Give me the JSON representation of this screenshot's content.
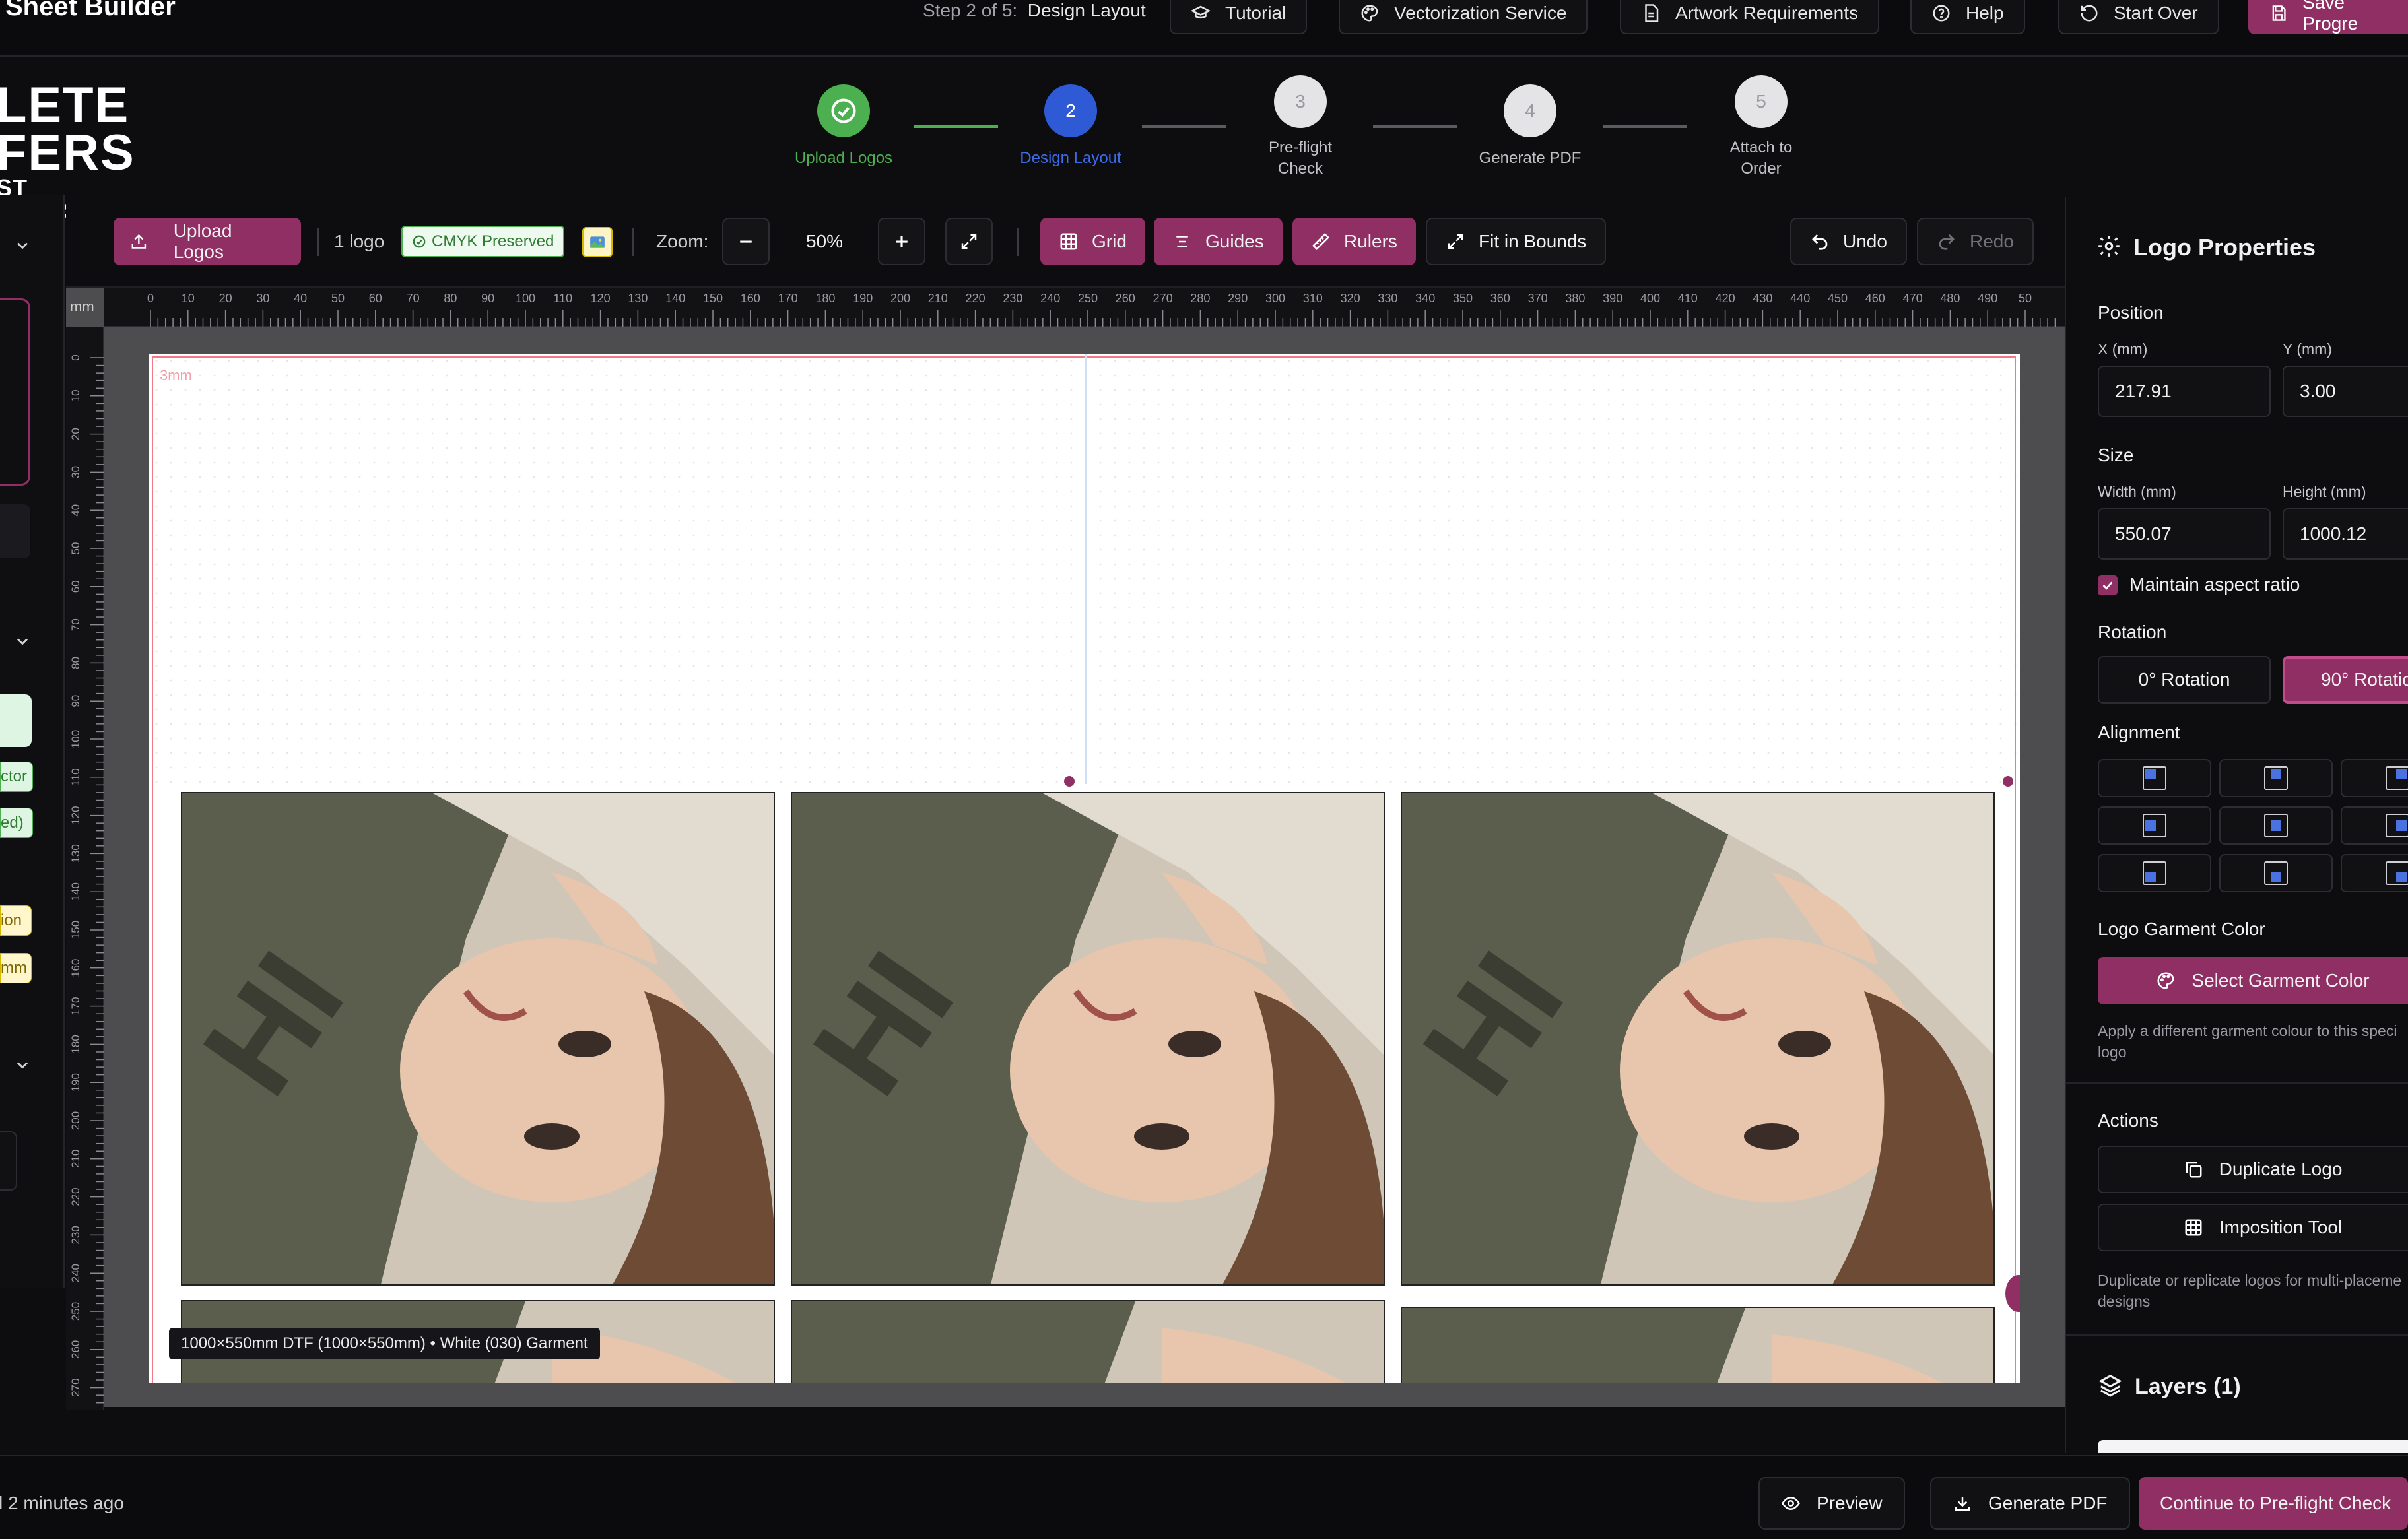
{
  "header": {
    "app_title": "Sheet Builder",
    "step_prefix": "Step 2 of 5:",
    "step_name": "Design Layout",
    "buttons": {
      "tutorial": "Tutorial",
      "vectorization": "Vectorization Service",
      "artwork": "Artwork Requirements",
      "help": "Help",
      "start_over": "Start Over",
      "save_progress": "Save Progre"
    }
  },
  "brand": {
    "line1": "LETE",
    "line2": "FERS",
    "line3": "ST PRESS"
  },
  "stepper": {
    "steps": [
      {
        "number": "1",
        "label": "Upload Logos",
        "status": "complete"
      },
      {
        "number": "2",
        "label": "Design Layout",
        "status": "current"
      },
      {
        "number": "3",
        "label": "Pre-flight Check",
        "status": "pending"
      },
      {
        "number": "4",
        "label": "Generate PDF",
        "status": "pending"
      },
      {
        "number": "5",
        "label": "Attach to Order",
        "status": "pending"
      }
    ]
  },
  "left_panel": {
    "tags": [
      "ctor",
      "ed)",
      "ion",
      "mm"
    ]
  },
  "toolbar": {
    "upload_logos": "Upload Logos",
    "logo_count": "1 logo",
    "cmyk_badge": "CMYK Preserved",
    "zoom_label": "Zoom:",
    "zoom_value": "50%",
    "grid": "Grid",
    "guides": "Guides",
    "rulers": "Rulers",
    "fit_in_bounds": "Fit in Bounds",
    "undo": "Undo",
    "redo": "Redo"
  },
  "ruler": {
    "unit": "mm",
    "top_ticks": [
      "0",
      "10",
      "20",
      "30",
      "40",
      "50",
      "60",
      "70",
      "80",
      "90",
      "100",
      "110",
      "120",
      "130",
      "140",
      "150",
      "160",
      "170",
      "180",
      "190",
      "200",
      "210",
      "220",
      "230",
      "240",
      "250",
      "260",
      "270",
      "280",
      "290",
      "300",
      "310",
      "320",
      "330",
      "340",
      "350",
      "360",
      "370",
      "380",
      "390",
      "400",
      "410",
      "420",
      "430",
      "440",
      "450",
      "460",
      "470",
      "480",
      "490",
      "50"
    ],
    "left_ticks": [
      "0",
      "10",
      "20",
      "30",
      "40",
      "50",
      "60",
      "70",
      "80",
      "90",
      "100",
      "110",
      "120",
      "130",
      "140",
      "150",
      "160",
      "170",
      "180",
      "190",
      "200",
      "210",
      "220",
      "230",
      "240",
      "250",
      "260",
      "270"
    ]
  },
  "canvas": {
    "bleed_label": "3mm",
    "caption": "1000×550mm DTF (1000×550mm) • White (030) Garment"
  },
  "properties": {
    "title": "Logo Properties",
    "position_label": "Position",
    "x_label": "X (mm)",
    "x_value": "217.91",
    "y_label": "Y (mm)",
    "y_value": "3.00",
    "size_label": "Size",
    "width_label": "Width (mm)",
    "width_value": "550.07",
    "height_label": "Height (mm)",
    "height_value": "1000.12",
    "maintain_aspect": "Maintain aspect ratio",
    "rotation_label": "Rotation",
    "rotation_0": "0° Rotation",
    "rotation_90": "90° Rotatio",
    "alignment_label": "Alignment",
    "garment_color_label": "Logo Garment Color",
    "select_garment": "Select Garment Color",
    "garment_help": "Apply a different garment colour to this speci logo",
    "actions_label": "Actions",
    "duplicate": "Duplicate Logo",
    "imposition": "Imposition Tool",
    "actions_help": "Duplicate or replicate logos for multi-placeme designs",
    "layers_title": "Layers (1)"
  },
  "footer": {
    "saved_text": "l 2 minutes ago",
    "preview": "Preview",
    "generate_pdf": "Generate PDF",
    "continue": "Continue to Pre-flight Check"
  },
  "colors": {
    "accent_pink": "#8f2f63",
    "step_complete": "#4caf50",
    "step_current": "#2f5ad6"
  }
}
